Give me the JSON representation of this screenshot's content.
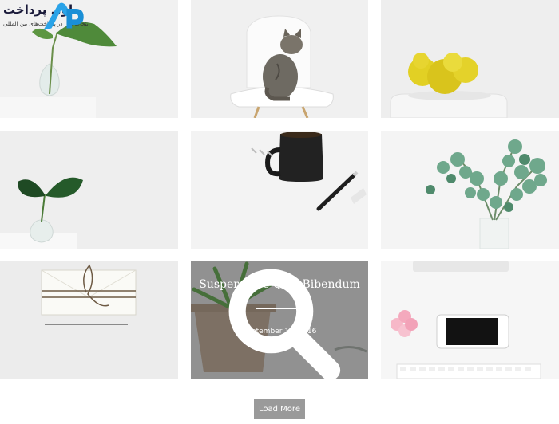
{
  "logo": {
    "name": "اول پرداخت",
    "tagline": "انتخاب اول در پرداخت‌های بین المللی",
    "mark_color": "#2aa3e8"
  },
  "featured_post": {
    "title": "Suspendisse Quis Bibendum",
    "date": "September 11, 2016"
  },
  "load_more_label": "Load More"
}
